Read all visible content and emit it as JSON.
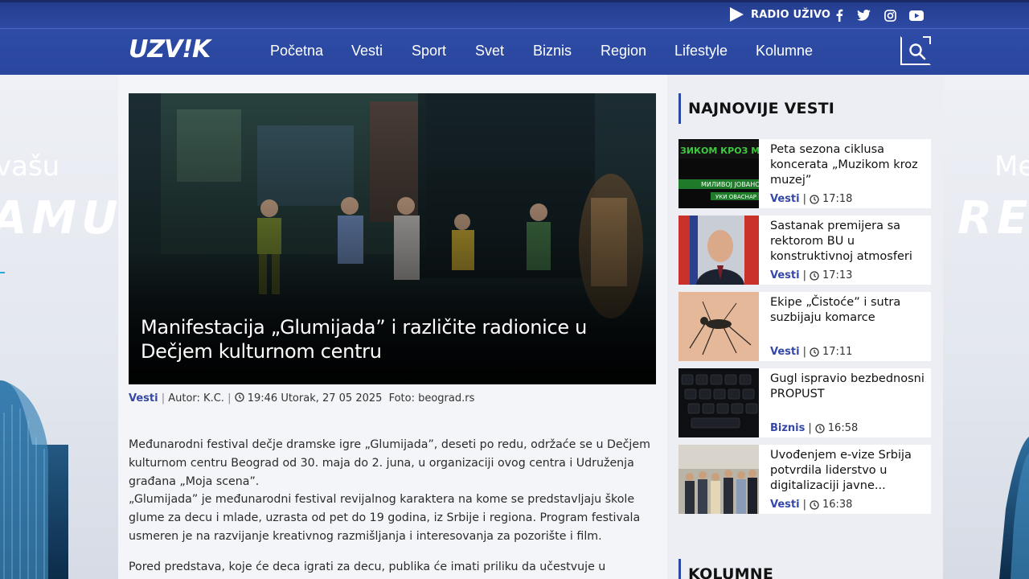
{
  "topbar": {
    "radio_label": "RADIO UŽIVO",
    "social": [
      "facebook-icon",
      "twitter-icon",
      "instagram-icon",
      "youtube-icon"
    ]
  },
  "nav": {
    "logo_left": "UZV",
    "logo_mark": "!",
    "logo_right": "K",
    "items": [
      "Početna",
      "Vesti",
      "Sport",
      "Svet",
      "Biznis",
      "Region",
      "Lifestyle",
      "Kolumne"
    ],
    "search_icon": "search-icon"
  },
  "banners": {
    "left_line1": "vašu",
    "left_line2": "AMU",
    "right_line1": "Me",
    "right_line2": "RE"
  },
  "article": {
    "title": "Manifestacija „Glumijada” i različite radionice u Dečjem kulturnom centru",
    "category": "Vesti",
    "author": "Autor: K.C.",
    "time": "19:46 Utorak, 27 05 2025",
    "photo": "Foto: beograd.rs",
    "paragraphs": [
      "Međunarodni festival dečje dramske igre „Glumijada”, deseti po redu, održaće se u Dečjem kulturnom centru Beograd od 30. maja do 2. juna, u organizaciji ovog centra i Udruženja građana „Moja scena”.",
      "„Glumijada” je međunarodni festival revijalnog karaktera na kome se predstavljaju škole glume za decu i mlade, uzrasta od pet do 19 godina, iz Srbije i regiona. Program festivala usmeren je na razvijanje kreativnog razmišljanja i interesovanja za pozorište i film.",
      "Pored predstava, koje će deca igrati za decu, publika će imati priliku da učestvuje u"
    ]
  },
  "sidebar": {
    "heading": "NAJNOVIJE VESTI",
    "heading2": "KOLUMNE",
    "news": [
      {
        "title": "Peta sezona ciklusa koncerata „Muzikom kroz muzej”",
        "category": "Vesti",
        "time": "17:18"
      },
      {
        "title": "Sastanak premijera sa rektorom BU u konstruktivnoj atmosferi",
        "category": "Vesti",
        "time": "17:13"
      },
      {
        "title": "Ekipe „Čistoće” i sutra suzbijaju komarce",
        "category": "Vesti",
        "time": "17:11"
      },
      {
        "title": "Gugl ispravio bezbednosni PROPUST",
        "category": "Biznis",
        "time": "16:58"
      },
      {
        "title": "Uvođenjem e-vize Srbija potvrdila liderstvo u digitalizaciji javne...",
        "category": "Vesti",
        "time": "16:38"
      }
    ],
    "poster_text": [
      "ЗИКОМ КРОЗ МУЗ",
      "МИЛИВОЈ ЈОВАНОВ",
      "УКИ ОВАСНАР"
    ]
  }
}
